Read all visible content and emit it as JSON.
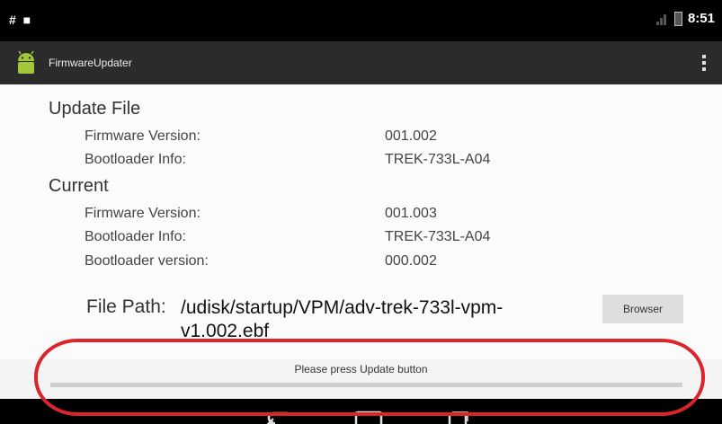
{
  "status_bar": {
    "left_icons": "# ■",
    "time": "8:51"
  },
  "action_bar": {
    "title": "FirmwareUpdater"
  },
  "update_file": {
    "heading": "Update File",
    "rows": [
      {
        "label": "Firmware Version:",
        "value": "001.002"
      },
      {
        "label": "Bootloader Info:",
        "value": "TREK-733L-A04"
      }
    ]
  },
  "current": {
    "heading": "Current",
    "rows": [
      {
        "label": "Firmware Version:",
        "value": "001.003"
      },
      {
        "label": "Bootloader Info:",
        "value": "TREK-733L-A04"
      },
      {
        "label": "Bootloader version:",
        "value": "000.002"
      }
    ]
  },
  "file_path": {
    "label": "File Path:",
    "value": "/udisk/startup/VPM/adv-trek-733l-vpm-v1.002.ebf",
    "browse_label": "Browser"
  },
  "status": {
    "message": "Please press Update button",
    "progress": 0
  },
  "colors": {
    "highlight": "#d9252b",
    "action_bar": "#2b2b2b",
    "android_green": "#a4c639"
  }
}
